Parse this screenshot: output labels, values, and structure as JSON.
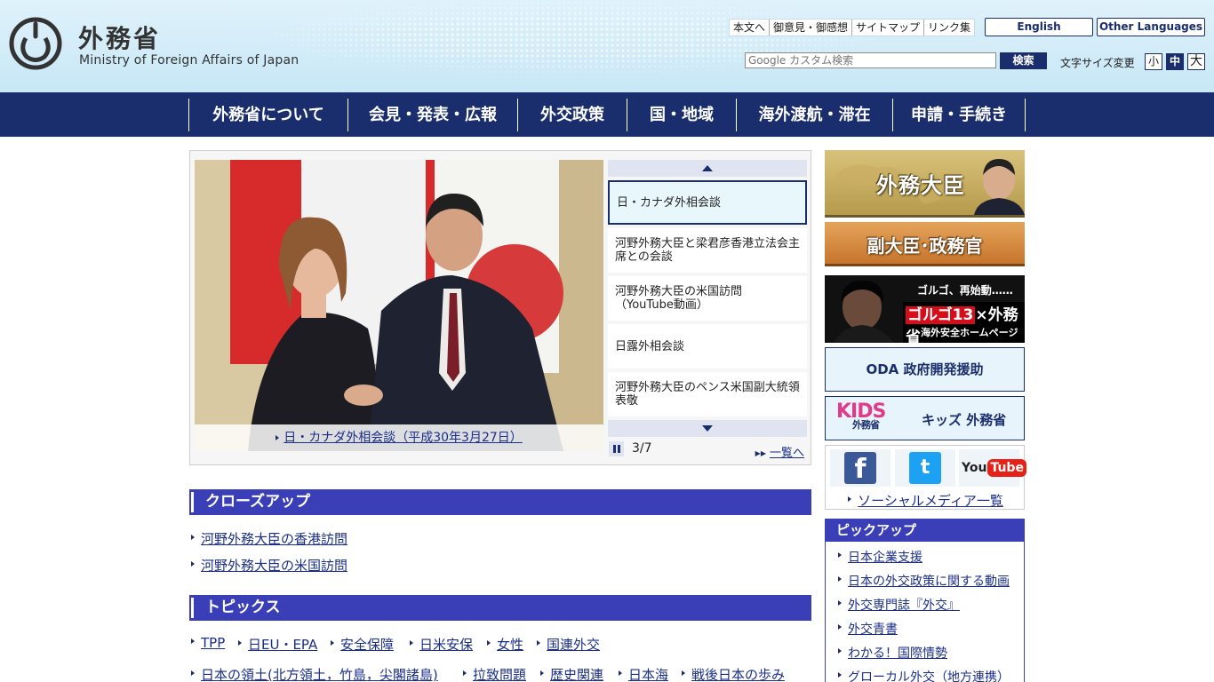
{
  "header": {
    "title_ja": "外務省",
    "title_en": "Ministry of Foreign Affairs of Japan",
    "util_links": [
      "本文へ",
      "御意見・御感想",
      "サイトマップ",
      "リンク集"
    ],
    "lang_english": "English",
    "lang_other": "Other Languages",
    "search_placeholder": "Google カスタム検索",
    "search_button": "検索",
    "fontsize_label": "文字サイズ変更",
    "fontsize_small": "小",
    "fontsize_mid": "中",
    "fontsize_large": "大"
  },
  "nav": {
    "items": [
      "外務省について",
      "会見・発表・広報",
      "外交政策",
      "国・地域",
      "海外渡航・滞在",
      "申請・手続き"
    ]
  },
  "slider": {
    "caption": "日・カナダ外相会談（平成30年3月27日）",
    "items": [
      "日・カナダ外相会談",
      "河野外務大臣と梁君彦香港立法会主席との会談",
      "河野外務大臣の米国訪問（YouTube動画）",
      "日露外相会談",
      "河野外務大臣のペンス米国副大統領表敬"
    ],
    "active_index": 0,
    "counter": "3/7",
    "list_link": "一覧へ"
  },
  "closeup": {
    "heading": "クローズアップ",
    "links": [
      "河野外務大臣の香港訪問",
      "河野外務大臣の米国訪問"
    ]
  },
  "topics": {
    "heading": "トピックス",
    "row1": [
      "TPP",
      "日EU・EPA",
      "安全保障",
      "日米安保",
      "女性",
      "国連外交"
    ],
    "row2": [
      "日本の領土(北方領土，竹島，尖閣諸島)",
      "拉致問題",
      "歴史関連",
      "日本海",
      "戦後日本の歩み"
    ]
  },
  "sidebar": {
    "minister": "外務大臣",
    "vice": "副大臣･政務官",
    "golgo_top": "ゴルゴ、再始動……",
    "golgo_main": "ゴルゴ13",
    "golgo_x": "×外務省",
    "golgo_sub": "海外安全ホームページ",
    "oda": "ODA 政府開発援助",
    "kids_logo": "KIDS",
    "kids_logo_sub": "外務省",
    "kids": "キッズ 外務省",
    "social_fb": "f",
    "social_tw": "t",
    "social_yt_you": "You",
    "social_yt_tube": "Tube",
    "social_all": "ソーシャルメディア一覧",
    "pickup_heading": "ピックアップ",
    "pickup_links": [
      "日本企業支援",
      "日本の外交政策に関する動画",
      "外交専門誌『外交』",
      "外交青書",
      "わかる！国際情勢",
      "グローカル外交（地方連携）"
    ]
  },
  "colors": {
    "navy": "#1a2e6e",
    "section_blue": "#3a3fb8",
    "header_sky": "#c8e7f6",
    "link": "#1a2e8a"
  }
}
